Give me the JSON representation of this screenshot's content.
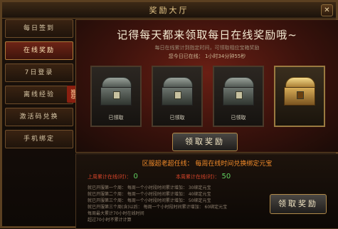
{
  "window": {
    "title": "奖励大厅",
    "close_label": "✕"
  },
  "sidebar": {
    "items": [
      {
        "label": "每日签到",
        "active": false
      },
      {
        "label": "在线奖励",
        "active": true
      },
      {
        "label": "7日登录",
        "active": false
      },
      {
        "label": "离线经验",
        "active": false,
        "badge": "推荐"
      },
      {
        "label": "激活码兑换",
        "active": false
      },
      {
        "label": "手机绑定",
        "active": false
      }
    ]
  },
  "main": {
    "headline": "记得每天都来领取每日在线奖励哦~",
    "tip1": "每日在线累计到指定时间，可领取相应宝箱奖励",
    "tip2": "您今日已在线：  1小时34分钟55秒",
    "chests": [
      {
        "label": "已领取",
        "type": "silver"
      },
      {
        "label": "已领取",
        "type": "silver"
      },
      {
        "label": "已领取",
        "type": "silver"
      },
      {
        "label": "",
        "type": "gold"
      }
    ],
    "claim_label": "领取奖励"
  },
  "bottom": {
    "title": "区服超老超任线：  每周在线时间兑换绑定元宝",
    "stat1_label": "上周累计在线(时)：",
    "stat1_value": "0",
    "stat2_label": "本周累计在线(时)：",
    "stat2_value": "50",
    "rules": [
      "就已开服第一个周：  每周一个小时段时间累计增加：  30绑定元宝",
      "就已开服第二个周：  每周一个小时段时间累计增加：  40绑定元宝",
      "就已开服第三个周：  每周一个小时段时间累计增加：  50绑定元宝",
      "就已开服第三个周(含)以后：  每周一个小时段时间累计增加：  60绑定元宝",
      "每周最大累计70小时在线时间",
      "超过70小时不累计计算"
    ],
    "claim_label": "领取奖励"
  }
}
